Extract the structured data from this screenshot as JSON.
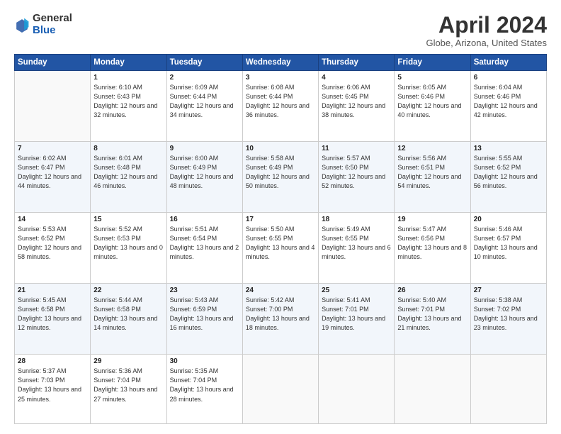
{
  "logo": {
    "general": "General",
    "blue": "Blue"
  },
  "title": "April 2024",
  "subtitle": "Globe, Arizona, United States",
  "headers": [
    "Sunday",
    "Monday",
    "Tuesday",
    "Wednesday",
    "Thursday",
    "Friday",
    "Saturday"
  ],
  "weeks": [
    [
      {
        "day": "",
        "sunrise": "",
        "sunset": "",
        "daylight": ""
      },
      {
        "day": "1",
        "sunrise": "Sunrise: 6:10 AM",
        "sunset": "Sunset: 6:43 PM",
        "daylight": "Daylight: 12 hours and 32 minutes."
      },
      {
        "day": "2",
        "sunrise": "Sunrise: 6:09 AM",
        "sunset": "Sunset: 6:44 PM",
        "daylight": "Daylight: 12 hours and 34 minutes."
      },
      {
        "day": "3",
        "sunrise": "Sunrise: 6:08 AM",
        "sunset": "Sunset: 6:44 PM",
        "daylight": "Daylight: 12 hours and 36 minutes."
      },
      {
        "day": "4",
        "sunrise": "Sunrise: 6:06 AM",
        "sunset": "Sunset: 6:45 PM",
        "daylight": "Daylight: 12 hours and 38 minutes."
      },
      {
        "day": "5",
        "sunrise": "Sunrise: 6:05 AM",
        "sunset": "Sunset: 6:46 PM",
        "daylight": "Daylight: 12 hours and 40 minutes."
      },
      {
        "day": "6",
        "sunrise": "Sunrise: 6:04 AM",
        "sunset": "Sunset: 6:46 PM",
        "daylight": "Daylight: 12 hours and 42 minutes."
      }
    ],
    [
      {
        "day": "7",
        "sunrise": "Sunrise: 6:02 AM",
        "sunset": "Sunset: 6:47 PM",
        "daylight": "Daylight: 12 hours and 44 minutes."
      },
      {
        "day": "8",
        "sunrise": "Sunrise: 6:01 AM",
        "sunset": "Sunset: 6:48 PM",
        "daylight": "Daylight: 12 hours and 46 minutes."
      },
      {
        "day": "9",
        "sunrise": "Sunrise: 6:00 AM",
        "sunset": "Sunset: 6:49 PM",
        "daylight": "Daylight: 12 hours and 48 minutes."
      },
      {
        "day": "10",
        "sunrise": "Sunrise: 5:58 AM",
        "sunset": "Sunset: 6:49 PM",
        "daylight": "Daylight: 12 hours and 50 minutes."
      },
      {
        "day": "11",
        "sunrise": "Sunrise: 5:57 AM",
        "sunset": "Sunset: 6:50 PM",
        "daylight": "Daylight: 12 hours and 52 minutes."
      },
      {
        "day": "12",
        "sunrise": "Sunrise: 5:56 AM",
        "sunset": "Sunset: 6:51 PM",
        "daylight": "Daylight: 12 hours and 54 minutes."
      },
      {
        "day": "13",
        "sunrise": "Sunrise: 5:55 AM",
        "sunset": "Sunset: 6:52 PM",
        "daylight": "Daylight: 12 hours and 56 minutes."
      }
    ],
    [
      {
        "day": "14",
        "sunrise": "Sunrise: 5:53 AM",
        "sunset": "Sunset: 6:52 PM",
        "daylight": "Daylight: 12 hours and 58 minutes."
      },
      {
        "day": "15",
        "sunrise": "Sunrise: 5:52 AM",
        "sunset": "Sunset: 6:53 PM",
        "daylight": "Daylight: 13 hours and 0 minutes."
      },
      {
        "day": "16",
        "sunrise": "Sunrise: 5:51 AM",
        "sunset": "Sunset: 6:54 PM",
        "daylight": "Daylight: 13 hours and 2 minutes."
      },
      {
        "day": "17",
        "sunrise": "Sunrise: 5:50 AM",
        "sunset": "Sunset: 6:55 PM",
        "daylight": "Daylight: 13 hours and 4 minutes."
      },
      {
        "day": "18",
        "sunrise": "Sunrise: 5:49 AM",
        "sunset": "Sunset: 6:55 PM",
        "daylight": "Daylight: 13 hours and 6 minutes."
      },
      {
        "day": "19",
        "sunrise": "Sunrise: 5:47 AM",
        "sunset": "Sunset: 6:56 PM",
        "daylight": "Daylight: 13 hours and 8 minutes."
      },
      {
        "day": "20",
        "sunrise": "Sunrise: 5:46 AM",
        "sunset": "Sunset: 6:57 PM",
        "daylight": "Daylight: 13 hours and 10 minutes."
      }
    ],
    [
      {
        "day": "21",
        "sunrise": "Sunrise: 5:45 AM",
        "sunset": "Sunset: 6:58 PM",
        "daylight": "Daylight: 13 hours and 12 minutes."
      },
      {
        "day": "22",
        "sunrise": "Sunrise: 5:44 AM",
        "sunset": "Sunset: 6:58 PM",
        "daylight": "Daylight: 13 hours and 14 minutes."
      },
      {
        "day": "23",
        "sunrise": "Sunrise: 5:43 AM",
        "sunset": "Sunset: 6:59 PM",
        "daylight": "Daylight: 13 hours and 16 minutes."
      },
      {
        "day": "24",
        "sunrise": "Sunrise: 5:42 AM",
        "sunset": "Sunset: 7:00 PM",
        "daylight": "Daylight: 13 hours and 18 minutes."
      },
      {
        "day": "25",
        "sunrise": "Sunrise: 5:41 AM",
        "sunset": "Sunset: 7:01 PM",
        "daylight": "Daylight: 13 hours and 19 minutes."
      },
      {
        "day": "26",
        "sunrise": "Sunrise: 5:40 AM",
        "sunset": "Sunset: 7:01 PM",
        "daylight": "Daylight: 13 hours and 21 minutes."
      },
      {
        "day": "27",
        "sunrise": "Sunrise: 5:38 AM",
        "sunset": "Sunset: 7:02 PM",
        "daylight": "Daylight: 13 hours and 23 minutes."
      }
    ],
    [
      {
        "day": "28",
        "sunrise": "Sunrise: 5:37 AM",
        "sunset": "Sunset: 7:03 PM",
        "daylight": "Daylight: 13 hours and 25 minutes."
      },
      {
        "day": "29",
        "sunrise": "Sunrise: 5:36 AM",
        "sunset": "Sunset: 7:04 PM",
        "daylight": "Daylight: 13 hours and 27 minutes."
      },
      {
        "day": "30",
        "sunrise": "Sunrise: 5:35 AM",
        "sunset": "Sunset: 7:04 PM",
        "daylight": "Daylight: 13 hours and 28 minutes."
      },
      {
        "day": "",
        "sunrise": "",
        "sunset": "",
        "daylight": ""
      },
      {
        "day": "",
        "sunrise": "",
        "sunset": "",
        "daylight": ""
      },
      {
        "day": "",
        "sunrise": "",
        "sunset": "",
        "daylight": ""
      },
      {
        "day": "",
        "sunrise": "",
        "sunset": "",
        "daylight": ""
      }
    ]
  ]
}
